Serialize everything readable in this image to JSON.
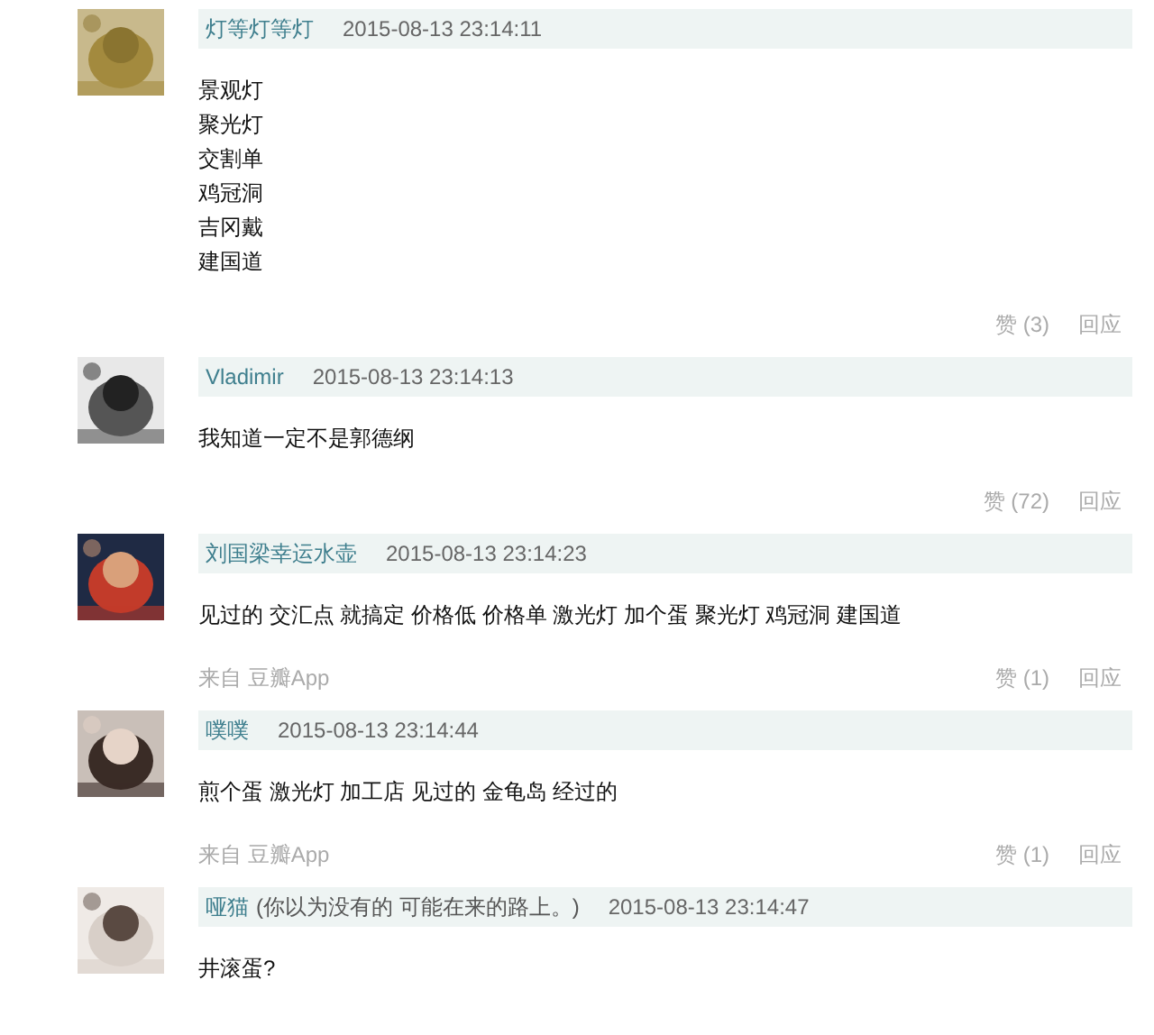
{
  "comments": [
    {
      "author": "灯等灯等灯",
      "time": "2015-08-13 23:14:11",
      "lines": [
        "景观灯",
        "聚光灯",
        "交割单",
        "鸡冠洞",
        "吉冈戴",
        "建国道"
      ],
      "footer": {
        "like": "赞 (3)",
        "reply": "回应"
      }
    },
    {
      "author": "Vladimir",
      "time": "2015-08-13 23:14:13",
      "lines": [
        "我知道一定不是郭德纲"
      ],
      "footer": {
        "like": "赞 (72)",
        "reply": "回应"
      }
    },
    {
      "author": "刘国梁幸运水壶",
      "time": "2015-08-13 23:14:23",
      "lines": [
        "见过的 交汇点 就搞定 价格低 价格单 激光灯 加个蛋 聚光灯 鸡冠洞 建国道"
      ],
      "footer": {
        "source": "来自 豆瓣App",
        "like": "赞 (1)",
        "reply": "回应"
      }
    },
    {
      "author": "噗噗",
      "time": "2015-08-13 23:14:44",
      "lines": [
        "煎个蛋 激光灯 加工店 见过的 金龟岛 经过的"
      ],
      "footer": {
        "source": "来自 豆瓣App",
        "like": "赞 (1)",
        "reply": "回应"
      }
    },
    {
      "author": "哑猫",
      "signature": "(你以为没有的 可能在来的路上。)",
      "time": "2015-08-13 23:14:47",
      "lines": [
        "井滚蛋?"
      ]
    }
  ]
}
